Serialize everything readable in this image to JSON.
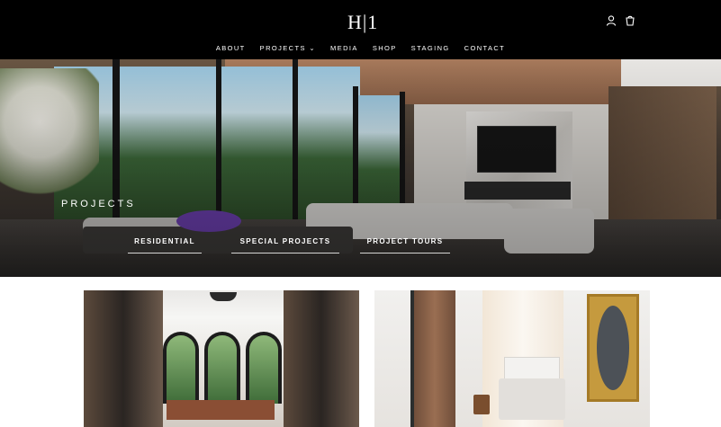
{
  "header": {
    "logo_text": "H|1",
    "nav": [
      "ABOUT",
      "PROJECTS ⌄",
      "MEDIA",
      "SHOP",
      "STAGING",
      "CONTACT"
    ],
    "icons": [
      "account-icon",
      "cart-icon"
    ]
  },
  "hero": {
    "title": "PROJECTS",
    "links": [
      "RESIDENTIAL",
      "SPECIAL PROJECTS",
      "PROJECT TOURS"
    ]
  },
  "colors": {
    "header_bg": "#000000",
    "text_light": "#ffffff"
  }
}
